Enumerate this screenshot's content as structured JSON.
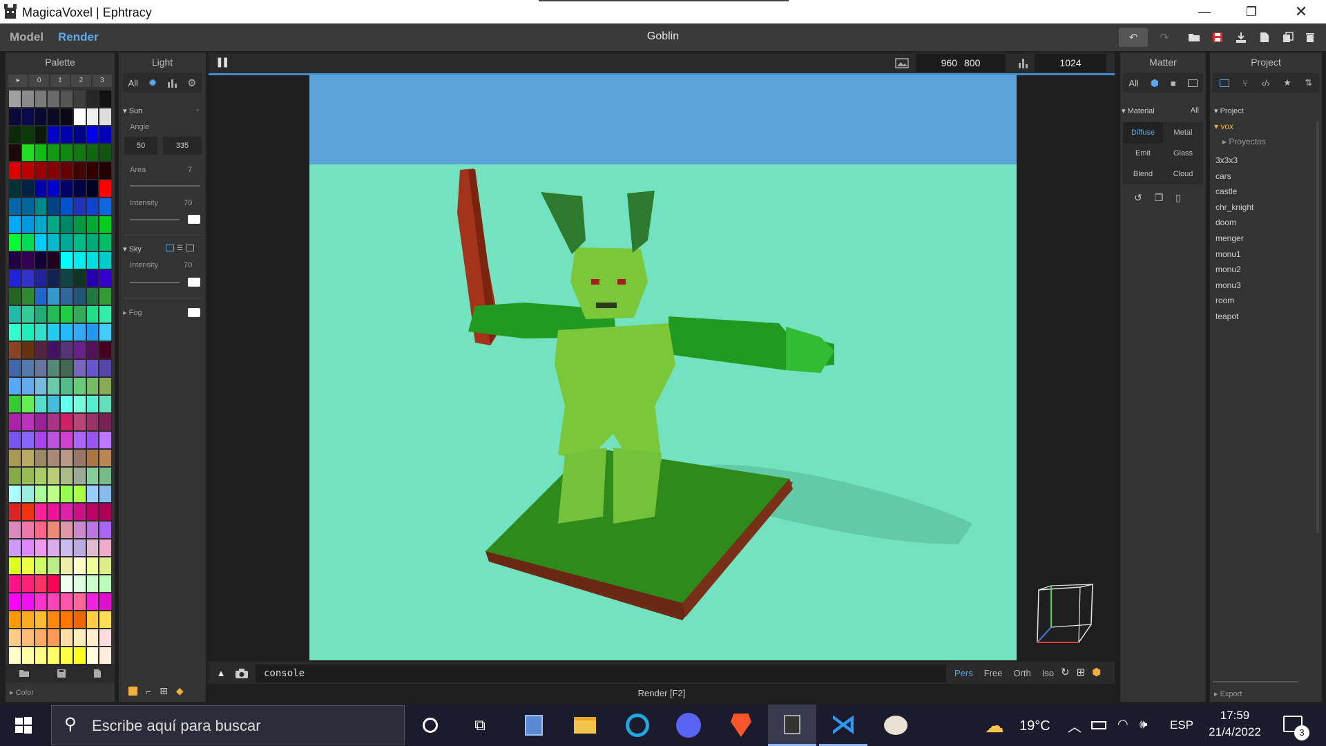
{
  "window": {
    "title": "MagicaVoxel | Ephtracy",
    "minimize": "—",
    "maximize": "❐",
    "close": "✕"
  },
  "topbar": {
    "model_tab": "Model",
    "render_tab": "Render",
    "document_title": "Goblin"
  },
  "palette": {
    "title": "Palette",
    "tabs": [
      "▸",
      "0",
      "1",
      "2",
      "3"
    ],
    "footer_label": "Color",
    "colors": [
      "#a0a0a0",
      "#8a8a8a",
      "#7a7a7a",
      "#6a6a6a",
      "#555555",
      "#3e3e3e",
      "#262626",
      "#111111",
      "#0a0a3c",
      "#0a0a4c",
      "#0a0a30",
      "#0a0a20",
      "#0a0a14",
      "#ffffff",
      "#eeeeee",
      "#dddddd",
      "#0a2a0a",
      "#0a3a0a",
      "#0a1a0a",
      "#0000cc",
      "#0000aa",
      "#000088",
      "#0000ee",
      "#0000bb",
      "#1a0a0a",
      "#22dd22",
      "#11bb11",
      "#119911",
      "#118811",
      "#117711",
      "#116611",
      "#115511",
      "#dd0000",
      "#bb0000",
      "#990000",
      "#880000",
      "#660000",
      "#440000",
      "#330000",
      "#220000",
      "#003333",
      "#002244",
      "#0000aa",
      "#0000cc",
      "#000066",
      "#000044",
      "#000022",
      "#ff0000",
      "#0066aa",
      "#006699",
      "#008888",
      "#004488",
      "#0055cc",
      "#2233bb",
      "#1144cc",
      "#1166dd",
      "#00aaff",
      "#0099dd",
      "#00aacc",
      "#00aa88",
      "#008866",
      "#009944",
      "#00aa33",
      "#00cc22",
      "#00ff33",
      "#00dd55",
      "#00ccff",
      "#00bbcc",
      "#00aa99",
      "#00bb88",
      "#00aa77",
      "#00bb66",
      "#220044",
      "#330055",
      "#110033",
      "#220022",
      "#00ffff",
      "#00eeee",
      "#00dddd",
      "#00cccc",
      "#2222dd",
      "#3333cc",
      "#222299",
      "#112255",
      "#114444",
      "#113322",
      "#2200aa",
      "#3300cc",
      "#226622",
      "#338833",
      "#2266cc",
      "#3399cc",
      "#336699",
      "#225577",
      "#227744",
      "#339933",
      "#22bbaa",
      "#33cc99",
      "#22aa77",
      "#22bb55",
      "#22cc44",
      "#33aa55",
      "#22dd88",
      "#33eeaa",
      "#33ffcc",
      "#22eebb",
      "#33ddcc",
      "#22ccee",
      "#22bbff",
      "#33aaff",
      "#2299ee",
      "#44ccff",
      "#884422",
      "#663311",
      "#552244",
      "#441166",
      "#553377",
      "#662288",
      "#551155",
      "#440022",
      "#4466aa",
      "#5577aa",
      "#667799",
      "#558877",
      "#446655",
      "#7766bb",
      "#6655cc",
      "#5544aa",
      "#55aaff",
      "#66aaee",
      "#77bbdd",
      "#66ccaa",
      "#55bb88",
      "#66cc77",
      "#77bb66",
      "#88aa55",
      "#33cc33",
      "#66ee55",
      "#55ddcc",
      "#44bbdd",
      "#66ffee",
      "#77ffdd",
      "#55eecc",
      "#66ddbb",
      "#aa22aa",
      "#bb33bb",
      "#992299",
      "#aa3388",
      "#cc2266",
      "#bb4477",
      "#993366",
      "#772255",
      "#7755ee",
      "#8866ff",
      "#aa44ee",
      "#bb55dd",
      "#cc44cc",
      "#aa66ff",
      "#9955ee",
      "#bb77ff",
      "#aa9955",
      "#bbaa66",
      "#998866",
      "#aa8877",
      "#bb9988",
      "#997766",
      "#aa7744",
      "#bb8855",
      "#88aa44",
      "#99bb55",
      "#aacc66",
      "#bbcc77",
      "#aabb88",
      "#99aa99",
      "#88cc99",
      "#77bb88",
      "#aaffff",
      "#99eedd",
      "#aaff99",
      "#bbff88",
      "#99ff55",
      "#aaff44",
      "#99ccff",
      "#88bbee",
      "#dd2222",
      "#ee3311",
      "#ff2299",
      "#ee1199",
      "#dd22aa",
      "#cc1188",
      "#bb0066",
      "#aa0055",
      "#dd88bb",
      "#ee77aa",
      "#ff6688",
      "#ee8877",
      "#dd99aa",
      "#cc88cc",
      "#bb77dd",
      "#aa66ee",
      "#cc99ff",
      "#dd88ff",
      "#ee99ee",
      "#ddaaee",
      "#ccbbee",
      "#bbaadd",
      "#ddbbcc",
      "#eeaacc",
      "#ddff22",
      "#eeff44",
      "#ccff66",
      "#bbee88",
      "#eeeeaa",
      "#ffffbb",
      "#eeff99",
      "#ddee88",
      "#ff1188",
      "#ff2277",
      "#ff3366",
      "#ff0055",
      "#eeffee",
      "#ddffdd",
      "#ccffcc",
      "#bbffbb",
      "#ff00ff",
      "#ee11ee",
      "#ff33cc",
      "#ff44bb",
      "#ff55aa",
      "#ff6699",
      "#ee22dd",
      "#dd11cc",
      "#ff9900",
      "#ffaa22",
      "#ffbb33",
      "#ff8811",
      "#ff7700",
      "#ee6600",
      "#ffcc44",
      "#ffdd55",
      "#ffcc88",
      "#ffbb77",
      "#ffaa66",
      "#ff9955",
      "#ffddaa",
      "#ffeebb",
      "#ffeecc",
      "#ffdddd",
      "#ffffcc",
      "#ffffaa",
      "#ffff88",
      "#ffff66",
      "#ffff44",
      "#ffff22",
      "#ffffdd",
      "#ffeedd"
    ]
  },
  "light": {
    "title": "Light",
    "filter_all": "All",
    "sun_label": "Sun",
    "angle_label": "Angle",
    "angle_a": "50",
    "angle_b": "335",
    "area_label": "Area",
    "area_value": "7",
    "sun_intensity_label": "Intensity",
    "sun_intensity_value": "70",
    "sky_label": "Sky",
    "sky_intensity_label": "Intensity",
    "sky_intensity_value": "70",
    "fog_label": "Fog"
  },
  "viewport": {
    "pause_glyph": "❚❚",
    "size_w": "960",
    "size_h": "800",
    "samples": "1024",
    "console_text": "console",
    "camera_modes": [
      "Pers",
      "Free",
      "Orth",
      "Iso"
    ],
    "status": "Render [F2]"
  },
  "matter": {
    "title": "Matter",
    "filter_all": "All",
    "material_label": "Material",
    "material_all": "All",
    "materials": [
      "Diffuse",
      "Metal",
      "Emit",
      "Glass",
      "Blend",
      "Cloud"
    ]
  },
  "project": {
    "title": "Project",
    "section_label": "Project",
    "root_folder": "vox",
    "subfolder": "Proyectos",
    "files": [
      "3x3x3",
      "cars",
      "castle",
      "chr_knight",
      "doom",
      "menger",
      "monu1",
      "monu2",
      "monu3",
      "room",
      "teapot"
    ],
    "export_label": "Export"
  },
  "taskbar": {
    "search_placeholder": "Escribe aquí para buscar",
    "weather": "19°C",
    "language": "ESP",
    "time": "17:59",
    "date": "21/4/2022",
    "notifications": "3"
  },
  "colors": {
    "accent": "#3a8fd8",
    "sky": "#5aa3d8",
    "ground": "#72e3be",
    "save_red": "#e03030"
  }
}
